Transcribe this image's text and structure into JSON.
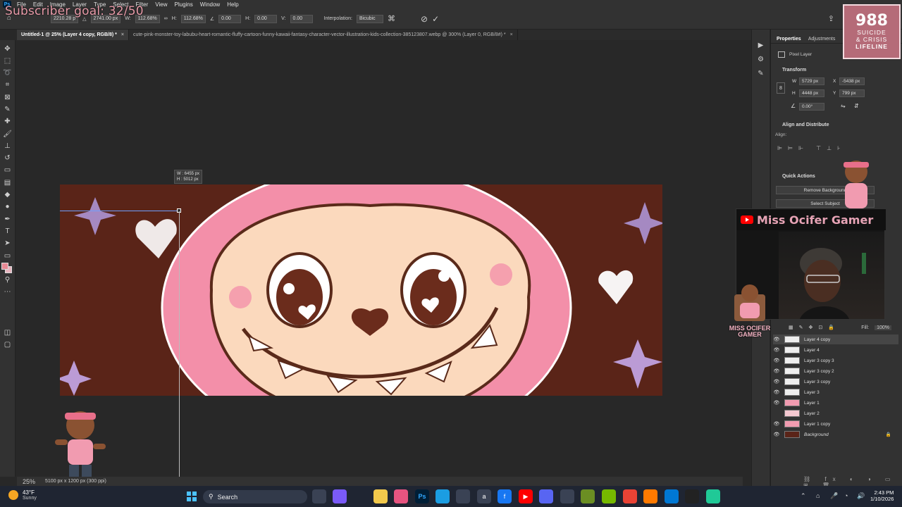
{
  "overlay": {
    "subscriber_goal": "Subscriber goal: 32/50",
    "hotline_number": "988",
    "hotline_line1": "SUICIDE",
    "hotline_line2": "& CRISIS",
    "hotline_line3": "LIFELINE",
    "channel_name": "Miss Ocifer Gamer",
    "logo_text_1": "MISS OCIFER",
    "logo_text_2": "GAMER"
  },
  "menubar": {
    "items": [
      "File",
      "Edit",
      "Image",
      "Layer",
      "Type",
      "Select",
      "Filter",
      "View",
      "Plugins",
      "Window",
      "Help"
    ]
  },
  "options": {
    "x_value": "2210.28 p",
    "y_value": "2741.00 px",
    "w_label": "W:",
    "w_value": "112.68%",
    "h_label": "H:",
    "h_value": "112.68%",
    "angle_value": "0.00",
    "h_skew_label": "H:",
    "h_skew_value": "0.00",
    "v_skew_label": "V:",
    "v_skew_value": "0.00",
    "interp_label": "Interpolation:",
    "interp_value": "Bicubic"
  },
  "tabs": [
    {
      "label": "Untitled-1 @ 25% (Layer 4 copy, RGB/8) *"
    },
    {
      "label": "cute-pink-monster-toy-labubu-heart-romantic-fluffy-cartoon-funny-kawaii-fantasy-character-vector-illustration-kids-collection-385123807.webp @ 300% (Layer 0, RGB/8#) *"
    }
  ],
  "canvas": {
    "tooltip_w": "W : 6455 px",
    "tooltip_h": "H : 5012 px"
  },
  "properties": {
    "tab1": "Properties",
    "tab2": "Adjustments",
    "layer_kind": "Pixel Layer",
    "transform_title": "Transform",
    "w_label": "W",
    "w_value": "5729 px",
    "x_label": "X",
    "x_value": "-5438 px",
    "h_label": "H",
    "h_value": "4448 px",
    "y_label": "Y",
    "y_value": "799 px",
    "angle_value": "0.00°",
    "align_title": "Align and Distribute",
    "align_label": "Align:",
    "quick_actions_title": "Quick Actions",
    "remove_bg": "Remove Background",
    "select_subject": "Select Subject"
  },
  "layers_panel": {
    "fill_label": "Fill:",
    "fill_value": "100%",
    "layers": [
      {
        "name": "Layer 4 copy",
        "visible": true,
        "selected": true
      },
      {
        "name": "Layer 4",
        "visible": true
      },
      {
        "name": "Layer 3 copy 3",
        "visible": true
      },
      {
        "name": "Layer 3 copy 2",
        "visible": true
      },
      {
        "name": "Layer 3 copy",
        "visible": true
      },
      {
        "name": "Layer 3",
        "visible": true
      },
      {
        "name": "Layer 1",
        "visible": true
      },
      {
        "name": "Layer 2",
        "visible": false
      },
      {
        "name": "Layer 1 copy",
        "visible": true
      },
      {
        "name": "Background",
        "visible": true,
        "locked": true
      }
    ]
  },
  "status": {
    "zoom": "25%",
    "doc_info": "5100 px x 1200 px (300 ppi)"
  },
  "taskbar": {
    "weather_temp": "43°F",
    "weather_cond": "Sunny",
    "search_label": "Search",
    "time": "2:43 PM",
    "date": "1/10/2026"
  },
  "colors": {
    "foreground": "#e88a95",
    "background": "#e8b6c0",
    "art_bg": "#5a2418",
    "monster_pink": "#f38fa9",
    "face": "#fbd9bd"
  }
}
